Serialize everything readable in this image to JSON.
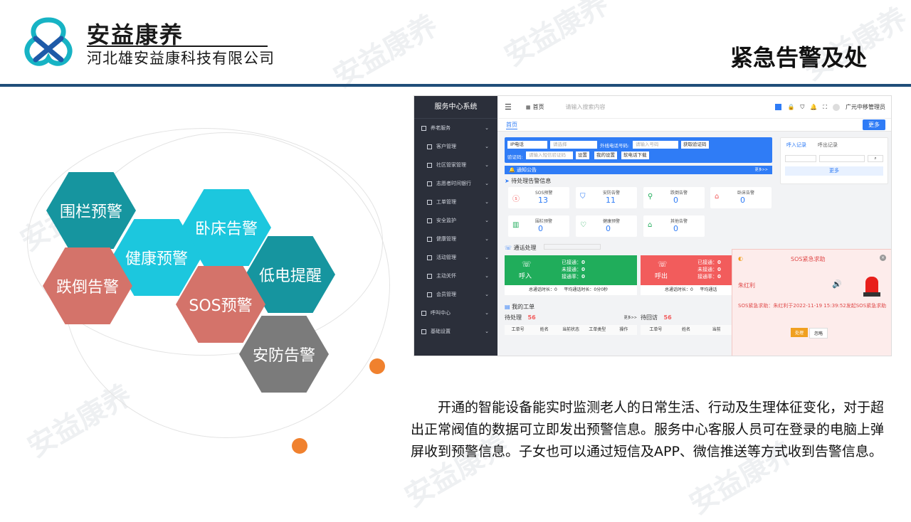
{
  "header": {
    "brand": "安益康养",
    "company": "河北雄安益康科技有限公司",
    "slide_title": "紧急告警及处",
    "watermark": "安益康养",
    "colors": {
      "rule": "#1f4e79",
      "logo_teal": "#17b3c4",
      "logo_blue": "#1e5aa8"
    }
  },
  "hexagons": [
    {
      "label": "围栏预警",
      "color": "#16959f"
    },
    {
      "label": "卧床告警",
      "color": "#1cc7de"
    },
    {
      "label": "健康预警",
      "color": "#1cc7de"
    },
    {
      "label": "低电提醒",
      "color": "#16959f"
    },
    {
      "label": "跌倒告警",
      "color": "#d4736a"
    },
    {
      "label": "SOS预警",
      "color": "#d4736a"
    },
    {
      "label": "安防告警",
      "color": "#7b7b7b"
    }
  ],
  "screenshot": {
    "sidebar": {
      "title": "服务中心系统",
      "items": [
        {
          "label": "养老服务",
          "sub": false
        },
        {
          "label": "客户管理",
          "sub": true
        },
        {
          "label": "社区管家管理",
          "sub": true
        },
        {
          "label": "志愿者时间银行",
          "sub": true
        },
        {
          "label": "工单管理",
          "sub": true
        },
        {
          "label": "安全监护",
          "sub": true
        },
        {
          "label": "健康管理",
          "sub": true
        },
        {
          "label": "活动管理",
          "sub": true
        },
        {
          "label": "主动关怀",
          "sub": true
        },
        {
          "label": "会员管理",
          "sub": true
        },
        {
          "label": "呼叫中心",
          "sub": false
        },
        {
          "label": "基础设置",
          "sub": false
        }
      ]
    },
    "topbar": {
      "home": "首页",
      "search_placeholder": "请输入搜索内容",
      "user": "广元中移管理员"
    },
    "tab_home": "首页",
    "more_button": "更多",
    "toolbar": {
      "ip_phone": "IP电话",
      "select_placeholder": "请选择",
      "outbound_label": "外线电话号码:",
      "outbound_placeholder": "请输入号码",
      "get_code": "获取验证码",
      "code_label": "验证码:",
      "code_placeholder": "请输入短信验证码",
      "settings": "设置",
      "my_settings": "我的设置",
      "download": "软电话下载"
    },
    "call_tabs": {
      "in": "呼入记录",
      "out": "呼出记录",
      "more": "更多"
    },
    "notice": {
      "label": "通知公告",
      "more": "更多>>"
    },
    "pending_title": "待处理告警信息",
    "alerts": [
      {
        "label": "SOS预警",
        "value": "13",
        "icon": "sos-icon"
      },
      {
        "label": "安防告警",
        "value": "11",
        "icon": "shield-icon"
      },
      {
        "label": "跌倒告警",
        "value": "0",
        "icon": "fall-icon"
      },
      {
        "label": "卧床告警",
        "value": "0",
        "icon": "bed-icon"
      },
      {
        "label": "围栏预警",
        "value": "0",
        "icon": "fence-icon"
      },
      {
        "label": "健康预警",
        "value": "0",
        "icon": "heart-icon"
      },
      {
        "label": "其他告警",
        "value": "0",
        "icon": "home-icon"
      }
    ],
    "call_handling": {
      "title": "通话处理",
      "inbound": {
        "label": "呼入",
        "connected": "已接通：",
        "c": "0",
        "missed": "未接通：",
        "m": "0",
        "rate": "接通率：",
        "r": "0"
      },
      "outbound": {
        "label": "呼出",
        "connected": "已接通：",
        "c": "0",
        "missed": "未接通：",
        "m": "0",
        "rate": "接通率：",
        "r": "0"
      },
      "total": "总通话时长：0",
      "avg": "平均通话时长：0分0秒",
      "total2": "总通话时长：0",
      "avg2": "平均通话"
    },
    "work_orders": {
      "title": "我的工单",
      "pending": "待处理",
      "pending_n": "56",
      "more": "更多>>",
      "followup": "待回访",
      "followup_n": "56",
      "cols": [
        "工单号",
        "姓名",
        "当前状态",
        "工单类型",
        "操作"
      ],
      "cols2": [
        "工单号",
        "姓名",
        "当前"
      ]
    },
    "sos_popup": {
      "title": "SOS紧急求助",
      "name": "朱红利",
      "message": "SOS紧急求助：朱红利于2022-11-19 15:39:52发起SOS紧急求助",
      "handle": "处理",
      "ignore": "忽略"
    }
  },
  "paragraph": "开通的智能设备能实时监测老人的日常生活、行动及生理体征变化，对于超出正常阀值的数据可立即发出预警信息。服务中心客服人员可在登录的电脑上弹屏收到预警信息。子女也可以通过短信及APP、微信推送等方式收到告警信息。"
}
